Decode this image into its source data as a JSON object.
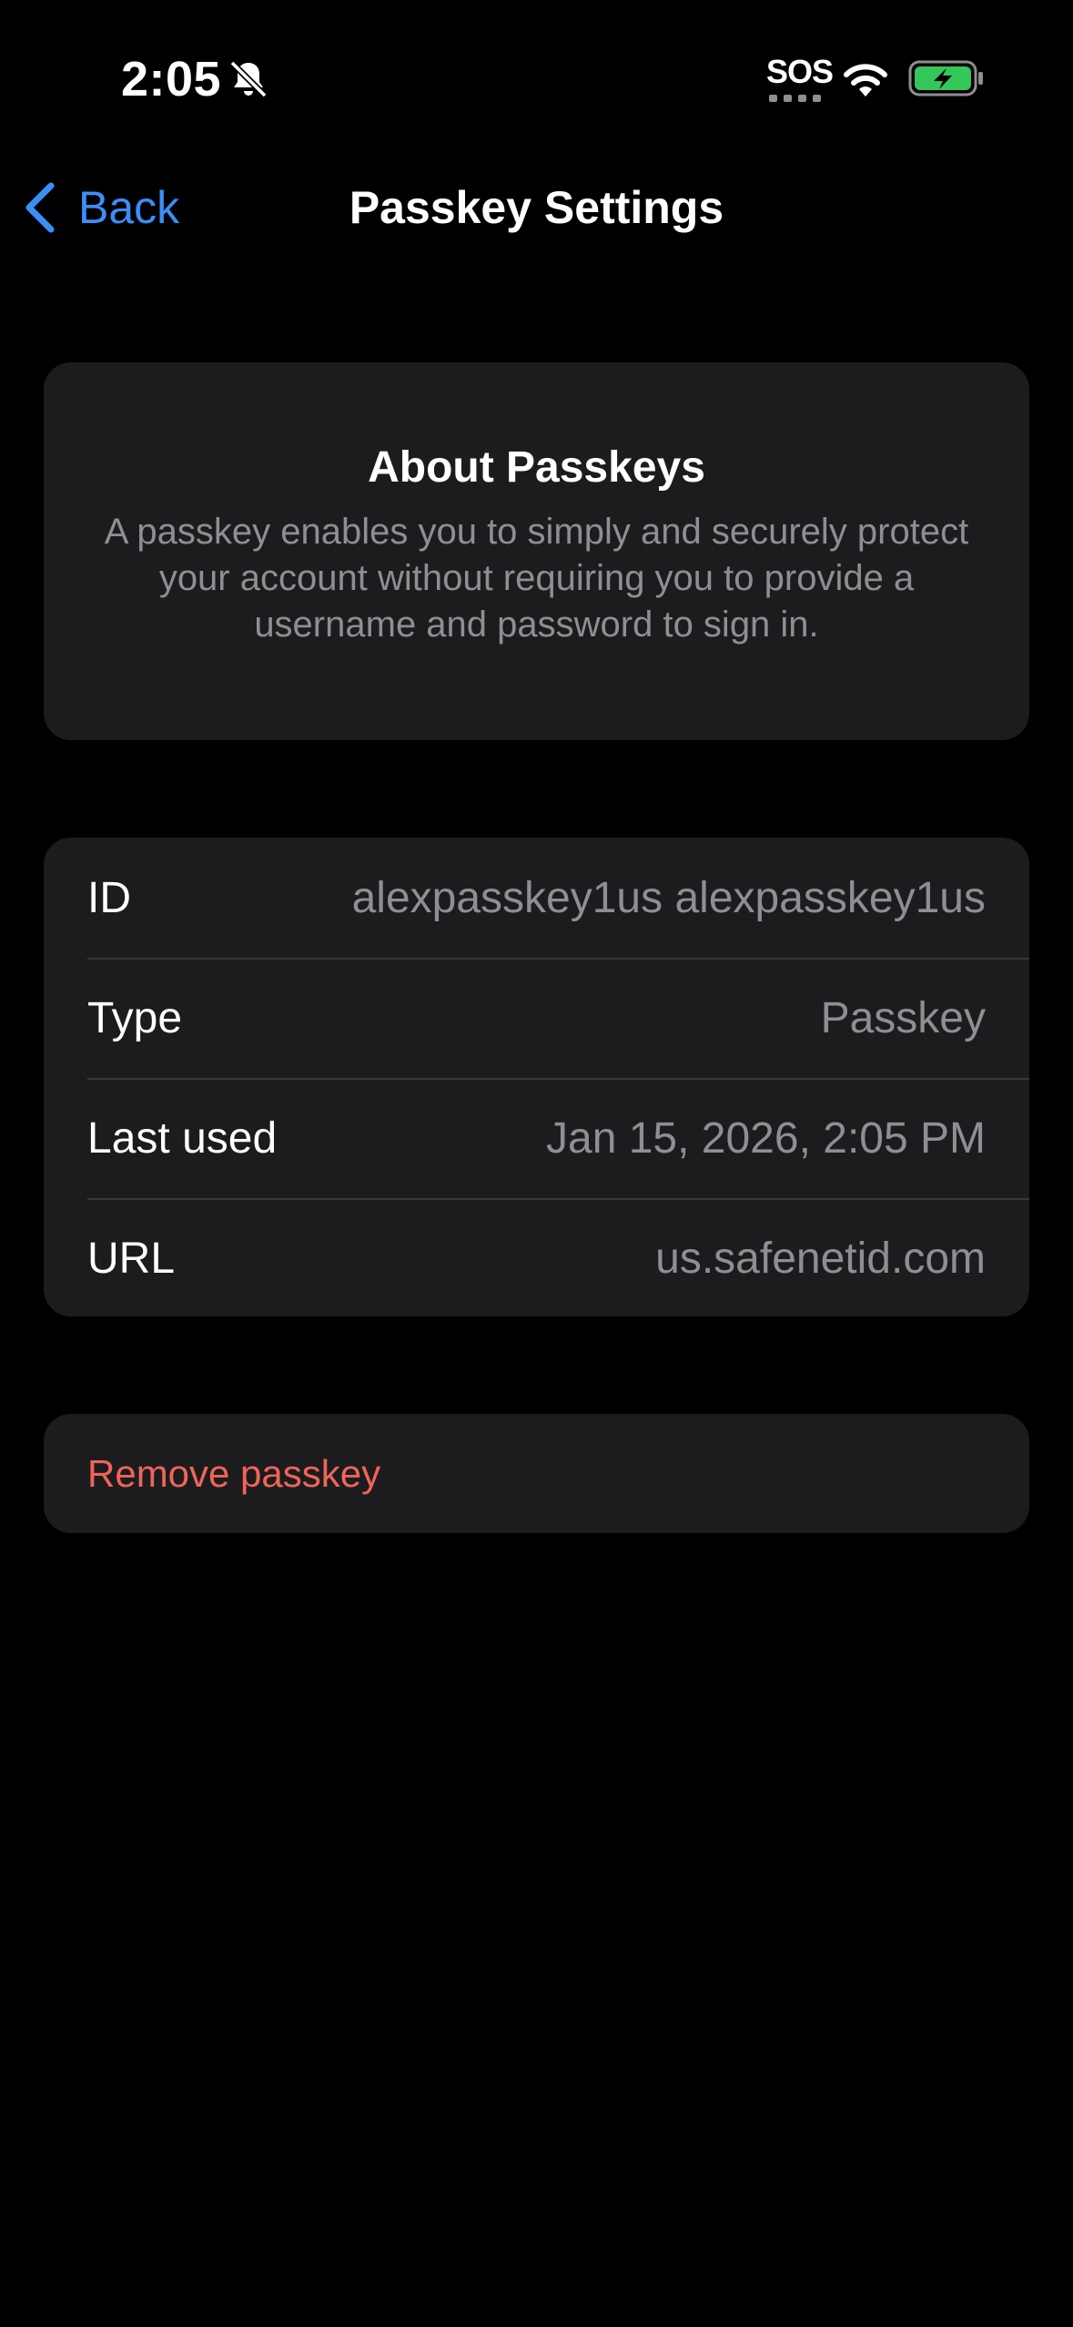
{
  "status_bar": {
    "time": "2:05",
    "silent_icon": "bell-slash-icon",
    "sos": "SOS",
    "wifi_icon": "wifi-icon",
    "battery_icon": "battery-charging-icon",
    "battery_color": "#34c759"
  },
  "nav": {
    "back_label": "Back",
    "title": "Passkey Settings"
  },
  "about": {
    "title": "About Passkeys",
    "body": "A passkey enables you to simply and securely protect your account without requiring you to provide a username and password to sign in."
  },
  "details": {
    "rows": [
      {
        "label": "ID",
        "value": "alexpasskey1us alexpasskey1us"
      },
      {
        "label": "Type",
        "value": "Passkey"
      },
      {
        "label": "Last used",
        "value": "Jan 15, 2026, 2:05 PM"
      },
      {
        "label": "URL",
        "value": "us.safenetid.com"
      }
    ]
  },
  "actions": {
    "remove_label": "Remove passkey"
  },
  "colors": {
    "accent": "#3a8ff7",
    "destructive": "#f0645a",
    "card_background": "#1c1c1e",
    "secondary_text": "#8e8e93"
  }
}
